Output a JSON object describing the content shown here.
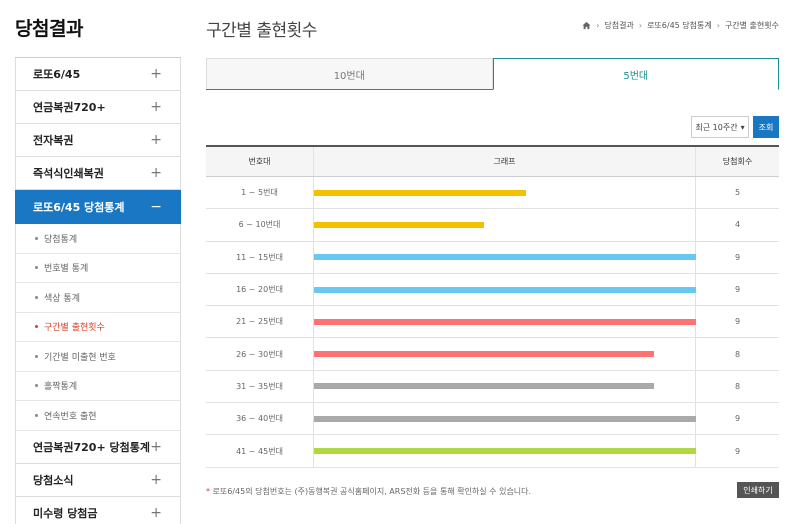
{
  "sidebar": {
    "title": "당첨결과",
    "menu_top": [
      {
        "label": "로또6/45",
        "icon": "plus-icon"
      },
      {
        "label": "연금복권720+",
        "icon": "plus-icon"
      },
      {
        "label": "전자복권",
        "icon": "plus-icon"
      },
      {
        "label": "즉석식인쇄복권",
        "icon": "plus-icon"
      },
      {
        "label": "로또6/45 당첨통계",
        "icon": "minus-icon",
        "active": true
      }
    ],
    "submenu": [
      {
        "label": "당첨통계"
      },
      {
        "label": "번호별 통계"
      },
      {
        "label": "색상 통계"
      },
      {
        "label": "구간별 출현횟수",
        "active": true
      },
      {
        "label": "기간별 미출현 번호"
      },
      {
        "label": "홀짝통계"
      },
      {
        "label": "연속번호 출현"
      }
    ],
    "menu_bottom": [
      {
        "label": "연금복권720+ 당첨통계"
      },
      {
        "label": "당첨소식"
      },
      {
        "label": "미수령 당첨금"
      }
    ],
    "plus_glyph": "+",
    "minus_glyph": "−"
  },
  "header": {
    "title": "구간별 출현횟수",
    "breadcrumb": [
      "당첨결과",
      "로또6/45 당첨통계",
      "구간별 출현횟수"
    ]
  },
  "tabs": [
    {
      "label": "10번대"
    },
    {
      "label": "5번대",
      "active": true
    }
  ],
  "filter": {
    "selected": "최근 10주간",
    "search_label": "조회"
  },
  "table": {
    "columns": [
      "번호대",
      "그래프",
      "당첨회수"
    ]
  },
  "chart_data": {
    "type": "bar",
    "categories": [
      "1 ~ 5번대",
      "6 ~ 10번대",
      "11 ~ 15번대",
      "16 ~ 20번대",
      "21 ~ 25번대",
      "26 ~ 30번대",
      "31 ~ 35번대",
      "36 ~ 40번대",
      "41 ~ 45번대"
    ],
    "values": [
      5,
      4,
      9,
      9,
      9,
      8,
      8,
      9,
      9
    ],
    "colors": [
      "#f2c200",
      "#f2c200",
      "#69c8f2",
      "#69c8f2",
      "#ff7272",
      "#ff7272",
      "#aaaaaa",
      "#aaaaaa",
      "#b0d840"
    ],
    "xmax": 9
  },
  "footer": {
    "note_star": "*",
    "note": "로또6/45의 당첨번호는 (주)동행복권 공식홈페이지, ARS전화 등을 통해 확인하실 수 있습니다.",
    "print_label": "인쇄하기"
  }
}
